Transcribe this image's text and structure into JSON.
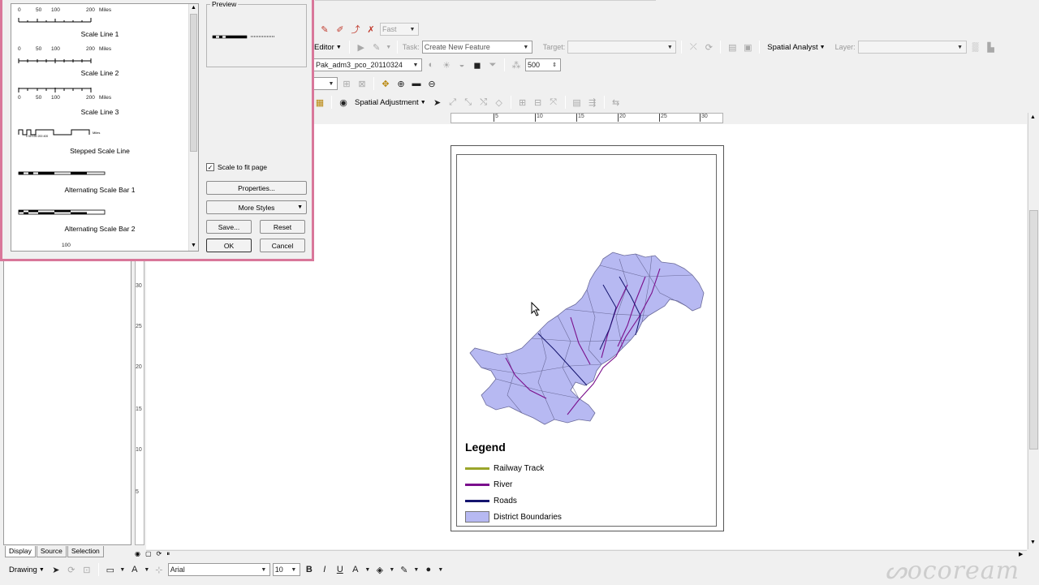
{
  "toolbar_row1": {
    "mode_value": "Fast"
  },
  "editor_toolbar": {
    "editor_label": "Editor",
    "task_label": "Task:",
    "task_value": "Create New Feature",
    "target_label": "Target:",
    "target_value": "",
    "spatial_analyst_label": "Spatial Analyst",
    "layer_label": "Layer:",
    "layer_value": ""
  },
  "layer_toolbar": {
    "layer_value": "Pak_adm3_pco_20110324",
    "scale_value": "500"
  },
  "spatial_adjustment_toolbar": {
    "label": "Spatial Adjustment"
  },
  "horizontal_ruler": {
    "ticks": [
      "5",
      "10",
      "15",
      "20",
      "25",
      "30"
    ]
  },
  "vertical_ruler": {
    "ticks": [
      "30",
      "25",
      "20",
      "15",
      "10",
      "5"
    ]
  },
  "legend": {
    "title": "Legend",
    "items": [
      {
        "label": "Railway Track",
        "color": "#9aa52a",
        "kind": "line"
      },
      {
        "label": "River",
        "color": "#7a0f8c",
        "kind": "line"
      },
      {
        "label": "Roads",
        "color": "#14146e",
        "kind": "line"
      },
      {
        "label": "District Boundaries",
        "color": "#b7b9f2",
        "kind": "patch"
      }
    ]
  },
  "map_colors": {
    "district_fill": "#b7b9f2",
    "district_stroke": "#6a6a9a",
    "river": "#7a0f8c",
    "road": "#14146e"
  },
  "toc_tabs": [
    "Display",
    "Source",
    "Selection"
  ],
  "dialog": {
    "styles": [
      {
        "name": "Scale Line 1",
        "numbers": [
          "0",
          "50",
          "100",
          "200",
          "Miles"
        ]
      },
      {
        "name": "Scale Line 2",
        "numbers": [
          "0",
          "50",
          "100",
          "200",
          "Miles"
        ]
      },
      {
        "name": "Scale Line 3",
        "numbers": [
          "0",
          "50",
          "100",
          "200",
          "Miles"
        ]
      },
      {
        "name": "Stepped Scale Line",
        "numbers": []
      },
      {
        "name": "Alternating Scale Bar 1",
        "numbers": []
      },
      {
        "name": "Alternating Scale Bar 2",
        "numbers": []
      },
      {
        "name": "",
        "numbers": [
          "100"
        ]
      }
    ],
    "preview_label": "Preview",
    "scale_to_fit_label": "Scale to fit page",
    "scale_to_fit_checked": true,
    "properties_label": "Properties...",
    "more_styles_label": "More Styles",
    "save_label": "Save...",
    "reset_label": "Reset",
    "ok_label": "OK",
    "cancel_label": "Cancel"
  },
  "drawing_toolbar": {
    "drawing_label": "Drawing",
    "font_value": "Arial",
    "font_size_value": "10"
  }
}
